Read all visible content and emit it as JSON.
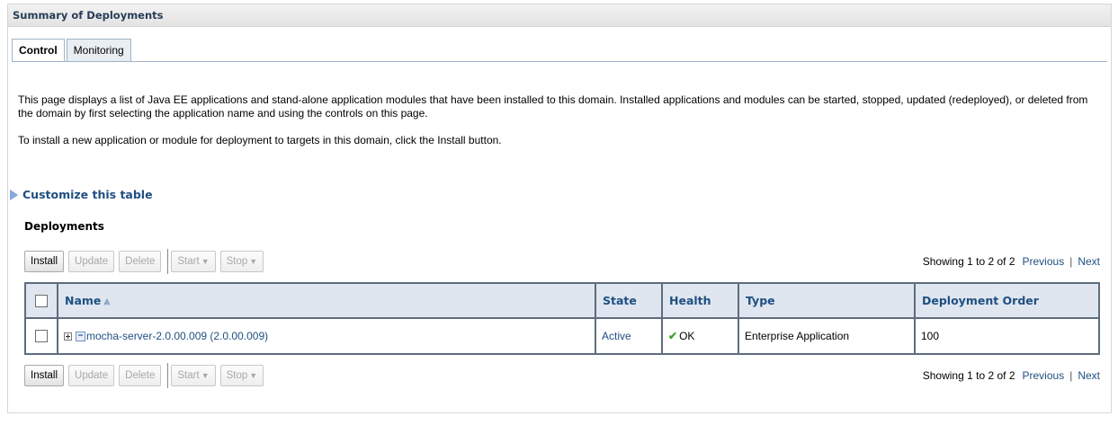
{
  "portlet": {
    "title": "Summary of Deployments"
  },
  "tabs": [
    {
      "label": "Control",
      "active": true
    },
    {
      "label": "Monitoring",
      "active": false
    }
  ],
  "description": {
    "para1": "This page displays a list of Java EE applications and stand-alone application modules that have been installed to this domain. Installed applications and modules can be started, stopped, updated (redeployed), or deleted from the domain by first selecting the application name and using the controls on this page.",
    "para2": "To install a new application or module for deployment to targets in this domain, click the Install button."
  },
  "customize": {
    "label": "Customize this table",
    "icon": "expand-triangle-icon"
  },
  "table": {
    "title": "Deployments",
    "toolbar": {
      "install": "Install",
      "update": "Update",
      "delete": "Delete",
      "start": "Start",
      "stop": "Stop"
    },
    "paging": {
      "showing": "Showing 1 to 2 of 2",
      "previous": "Previous",
      "separator": "|",
      "next": "Next"
    },
    "columns": [
      "Name",
      "State",
      "Health",
      "Type",
      "Deployment Order"
    ],
    "rows": [
      {
        "name": "mocha-server-2.0.00.009 (2.0.00.009)",
        "state": "Active",
        "health": "OK",
        "type": "Enterprise Application",
        "order": "100"
      }
    ]
  },
  "colors": {
    "link": "#1f4f82",
    "header_bg": "#dfe6ef",
    "ok_check": "#3aa22b"
  }
}
